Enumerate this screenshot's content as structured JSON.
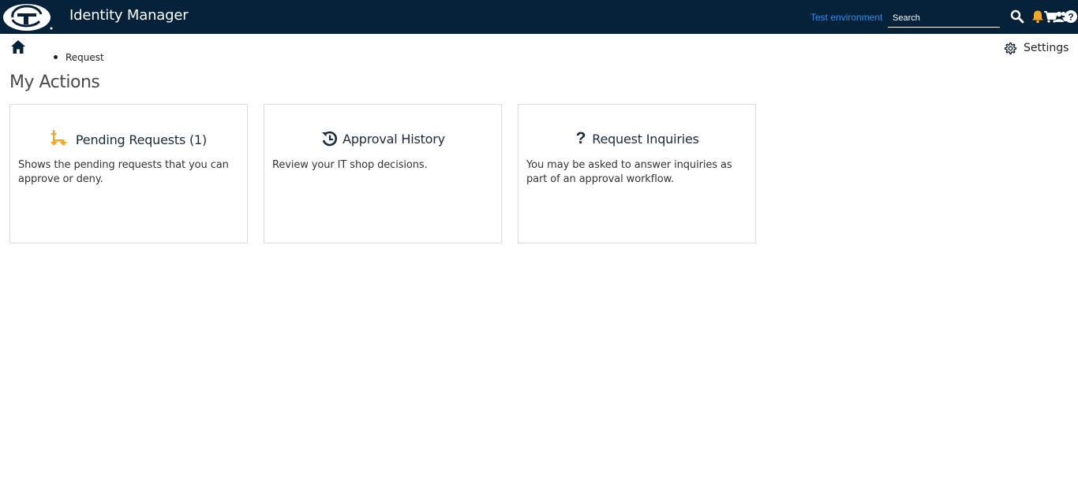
{
  "header": {
    "app_title": "Identity Manager",
    "environment": "Test environment",
    "search": {
      "placeholder": "Search",
      "value": ""
    },
    "icons": [
      "logo-icon",
      "search-icon",
      "bell-icon",
      "cart-icon",
      "users-icon",
      "help-icon"
    ],
    "colors": {
      "background": "#06213a",
      "environment_text": "#2f8de4",
      "bell": "#f5a623"
    }
  },
  "breadcrumb": {
    "items": [
      "Request"
    ]
  },
  "settings": {
    "label": "Settings"
  },
  "page": {
    "title": "My Actions"
  },
  "cards": [
    {
      "title": "Pending Requests (1)",
      "description": "Shows the pending requests that you can approve or deny.",
      "icon": "pending-requests-icon",
      "icon_color": "#f5a623"
    },
    {
      "title": "Approval History",
      "description": "Review your IT shop decisions.",
      "icon": "history-icon",
      "icon_color": "#1b2a3a"
    },
    {
      "title": "Request Inquiries",
      "description": "You may be asked to answer inquiries as part of an approval workflow.",
      "icon": "question-icon",
      "icon_color": "#1b2a3a"
    }
  ]
}
